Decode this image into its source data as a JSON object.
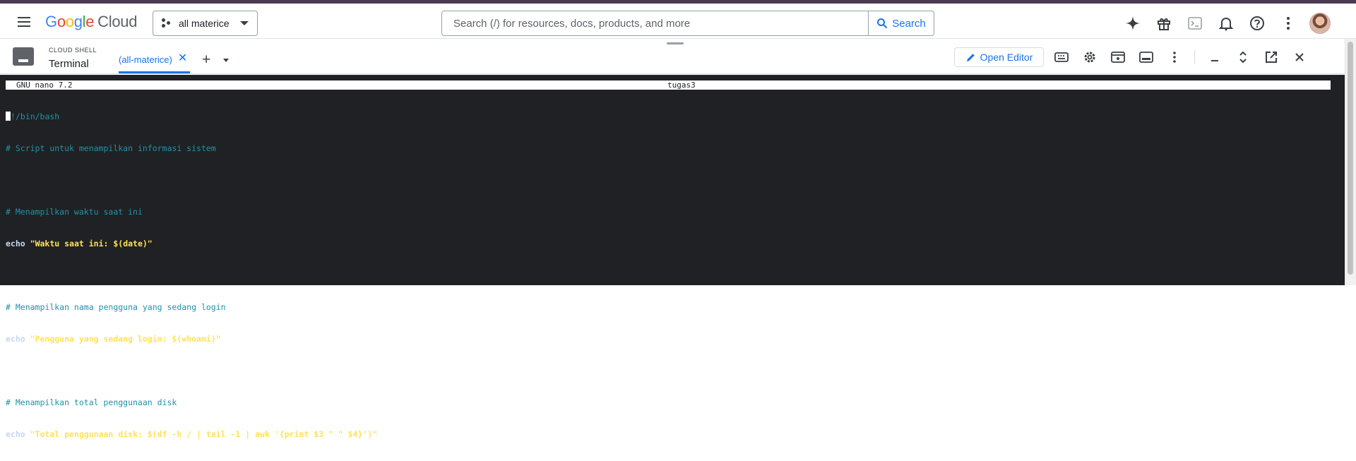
{
  "header": {
    "logo_google": "Google",
    "logo_cloud": "Cloud",
    "project": "all materice",
    "search_placeholder": "Search (/) for resources, docs, products, and more",
    "search_button": "Search"
  },
  "shell": {
    "caption": "CLOUD SHELL",
    "title": "Terminal",
    "tab_label": "(all-materice)",
    "open_editor": "Open Editor"
  },
  "terminal": {
    "nano_version": "GNU nano 7.2",
    "file_name": "tugas3",
    "line1": "!/bin/bash",
    "line2": "# Script untuk menampilkan informasi sistem",
    "line4": "# Menampilkan waktu saat ini",
    "line5_kw": "echo",
    "line5_str": "\"Waktu saat ini: $(date)\"",
    "line7": "# Menampilkan nama pengguna yang sedang login",
    "line8_kw": "echo",
    "line8_str": "\"Pengguna yang sedang login: $(whoami)\"",
    "line10": "# Menampilkan total penggunaan disk",
    "line11_kw": "echo",
    "line11_str": "\"Total penggunaan disk: $(df -h / | tail -1 | awk '{print $3 \" \" $4}')\""
  },
  "colors": {
    "accent": "#1a73e8",
    "terminal_bg": "#202124",
    "comment": "#1e93a8",
    "string": "#ffe258"
  }
}
